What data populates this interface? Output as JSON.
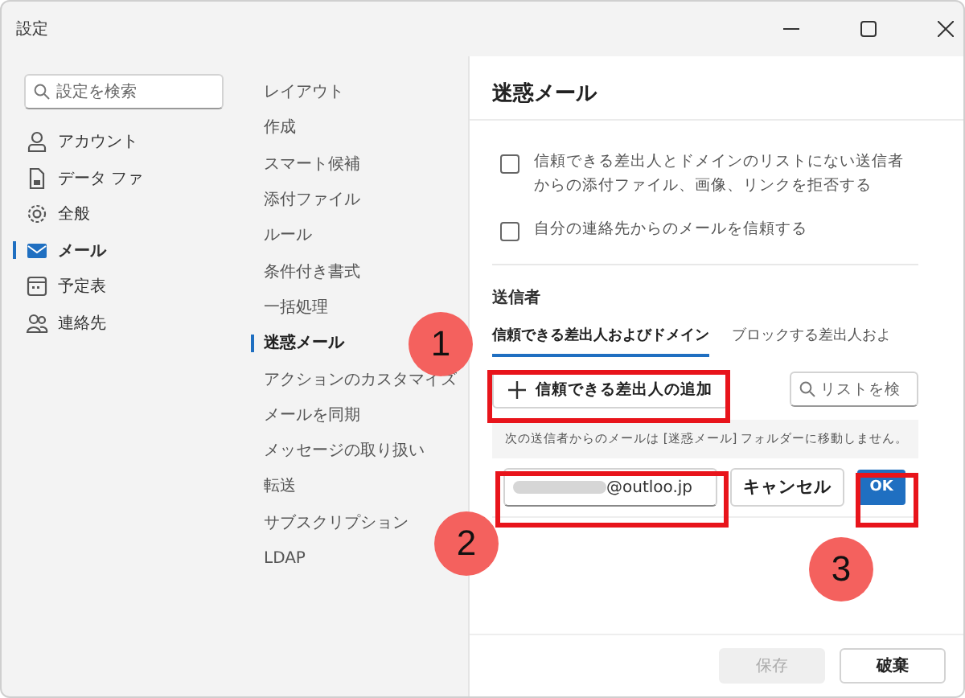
{
  "window": {
    "title": "設定"
  },
  "sidebar": {
    "search": {
      "placeholder": "設定を検索"
    },
    "items": [
      {
        "label": "アカウント",
        "selected": false
      },
      {
        "label": "データ ファ",
        "selected": false
      },
      {
        "label": "全般",
        "selected": false
      },
      {
        "label": "メール",
        "selected": true
      },
      {
        "label": "予定表",
        "selected": false
      },
      {
        "label": "連絡先",
        "selected": false
      }
    ]
  },
  "subnav": {
    "items": [
      {
        "label": "レイアウト",
        "selected": false
      },
      {
        "label": "作成",
        "selected": false
      },
      {
        "label": "スマート候補",
        "selected": false
      },
      {
        "label": "添付ファイル",
        "selected": false
      },
      {
        "label": "ルール",
        "selected": false
      },
      {
        "label": "条件付き書式",
        "selected": false
      },
      {
        "label": "一括処理",
        "selected": false
      },
      {
        "label": "迷惑メール",
        "selected": true
      },
      {
        "label": "アクションのカスタマイズ",
        "selected": false
      },
      {
        "label": "メールを同期",
        "selected": false
      },
      {
        "label": "メッセージの取り扱い",
        "selected": false
      },
      {
        "label": "転送",
        "selected": false
      },
      {
        "label": "サブスクリプション",
        "selected": false
      },
      {
        "label": "LDAP",
        "selected": false
      }
    ]
  },
  "panel": {
    "title": "迷惑メール",
    "options": [
      {
        "label": "信頼できる差出人とドメインのリストにない送信者からの添付ファイル、画像、リンクを拒否する",
        "checked": false
      },
      {
        "label": "自分の連絡先からのメールを信頼する",
        "checked": false
      }
    ],
    "section_title": "送信者",
    "tabs": [
      {
        "label": "信頼できる差出人およびドメイン",
        "selected": true
      },
      {
        "label": "ブロックする差出人およ",
        "selected": false
      }
    ],
    "add_button": "信頼できる差出人の追加",
    "list_search": {
      "placeholder": "リストを検"
    },
    "info": "次の送信者からのメールは [迷惑メール] フォルダーに移動しません。",
    "email_input": {
      "value": "@outloo.jp"
    },
    "cancel_button": "キャンセル",
    "ok_button": "OK",
    "footer": [
      {
        "label": "保存",
        "disabled": true
      },
      {
        "label": "破棄",
        "disabled": false
      }
    ]
  },
  "callouts": [
    {
      "label": "1"
    },
    {
      "label": "2"
    },
    {
      "label": "3"
    }
  ]
}
